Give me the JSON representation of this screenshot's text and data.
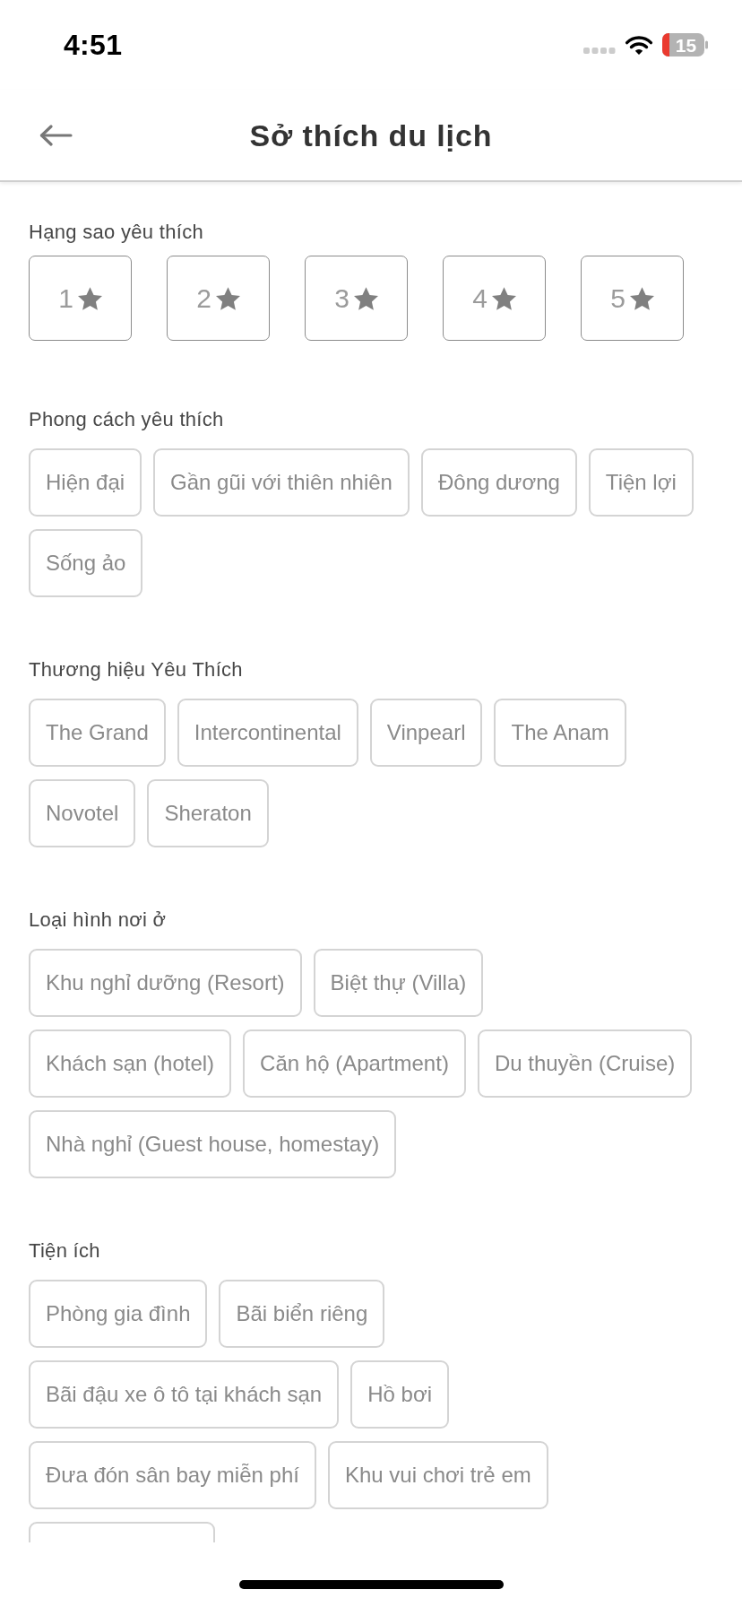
{
  "status_bar": {
    "time": "4:51",
    "battery": "15"
  },
  "header": {
    "title": "Sở thích du lịch"
  },
  "star_rating": {
    "label": "Hạng sao yêu thích",
    "options": [
      {
        "label": "1",
        "selected": false
      },
      {
        "label": "2",
        "selected": false
      },
      {
        "label": "3",
        "selected": false
      },
      {
        "label": "4",
        "selected": false
      },
      {
        "label": "5",
        "selected": false
      }
    ]
  },
  "sections": [
    {
      "label": "Phong cách yêu thích",
      "items": [
        {
          "label": "Hiện đại",
          "selected": false
        },
        {
          "label": "Gần gũi với thiên nhiên",
          "selected": false
        },
        {
          "label": "Đông dương",
          "selected": false
        },
        {
          "label": "Tiện lợi",
          "selected": false
        },
        {
          "label": "Sống ảo",
          "selected": false
        }
      ]
    },
    {
      "label": "Thương hiệu Yêu Thích",
      "items": [
        {
          "label": "The Grand",
          "selected": false
        },
        {
          "label": "Intercontinental",
          "selected": false
        },
        {
          "label": "Vinpearl",
          "selected": false
        },
        {
          "label": "The Anam",
          "selected": false
        },
        {
          "label": "Novotel",
          "selected": false
        },
        {
          "label": "Sheraton",
          "selected": false
        }
      ]
    },
    {
      "label": "Loại hình nơi ở",
      "items": [
        {
          "label": "Khu nghỉ dưỡng (Resort)",
          "selected": false
        },
        {
          "label": "Biệt thự (Villa)",
          "selected": false
        },
        {
          "label": "Khách sạn (hotel)",
          "selected": false
        },
        {
          "label": "Căn hộ (Apartment)",
          "selected": false
        },
        {
          "label": "Du thuyền (Cruise)",
          "selected": false
        },
        {
          "label": "Nhà nghỉ (Guest house, homestay)",
          "selected": false
        }
      ]
    },
    {
      "label": "Tiện ích",
      "items": [
        {
          "label": "Phòng gia đình",
          "selected": false
        },
        {
          "label": "Bãi biển riêng",
          "selected": false
        },
        {
          "label": "Bãi đậu xe ô tô tại khách sạn",
          "selected": false
        },
        {
          "label": "Hồ bơi",
          "selected": false
        },
        {
          "label": "Đưa đón sân bay miễn phí",
          "selected": false
        },
        {
          "label": "Khu vui chơi trẻ em",
          "selected": false
        }
      ],
      "cut_off_chip": true
    }
  ]
}
